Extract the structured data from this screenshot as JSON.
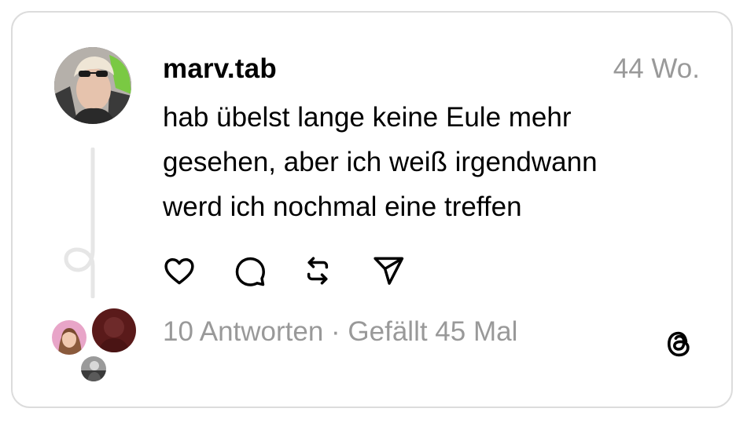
{
  "post": {
    "username": "marv.tab",
    "timestamp": "44 Wo.",
    "text_lines": [
      "hab übelst lange keine Eule mehr",
      "gesehen, aber ich weiß irgendwann",
      "werd ich nochmal eine treffen"
    ]
  },
  "actions": {
    "icons": [
      "heart-icon",
      "comment-icon",
      "repost-icon",
      "share-icon"
    ]
  },
  "stats": {
    "replies": "10 Antworten",
    "separator": " · ",
    "likes": "Gefällt 45 Mal"
  },
  "colors": {
    "text": "#000000",
    "muted": "#999999",
    "border": "#dcdcdc",
    "thread_line": "#e6e6e6"
  }
}
